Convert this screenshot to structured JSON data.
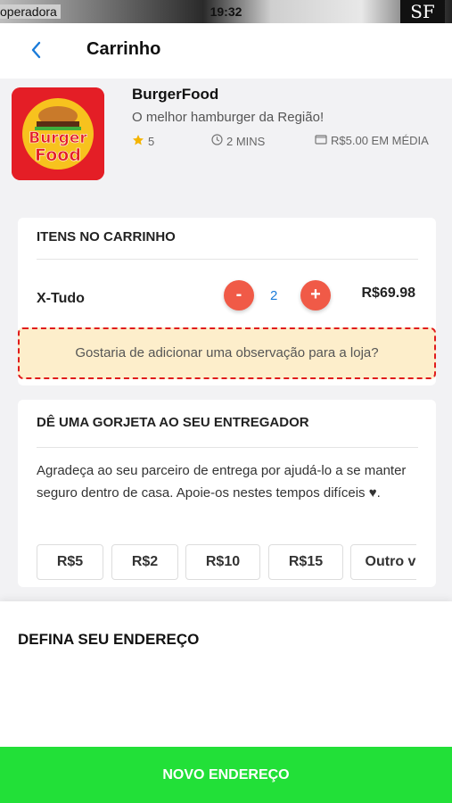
{
  "status_bar": {
    "carrier": "operadora",
    "time": "19:32",
    "corner_logo": "SF"
  },
  "header": {
    "back_icon": "chevron-left-icon",
    "title": "Carrinho"
  },
  "store": {
    "name": "BurgerFood",
    "tagline": "O melhor hamburger da Região!",
    "rating": "5",
    "delivery_time": "2 MINS",
    "avg_price": "R$5.00 EM MÉDIA",
    "logo_text_top": "Burger",
    "logo_text_bottom": "Food"
  },
  "cart": {
    "title": "ITENS NO CARRINHO",
    "items": [
      {
        "name": "X-Tudo",
        "quantity": "2",
        "price": "R$69.98",
        "minus_label": "-",
        "plus_label": "+"
      }
    ],
    "observation_prompt": "Gostaria de adicionar uma observação para a loja?"
  },
  "tip": {
    "title": "DÊ UMA GORJETA AO SEU ENTREGADOR",
    "description": "Agradeça ao seu parceiro de entrega por ajudá-lo a se manter seguro dentro de casa. Apoie-os nestes tempos difíceis ♥.",
    "options": [
      "R$5",
      "R$2",
      "R$10",
      "R$15",
      "Outro v"
    ]
  },
  "address": {
    "title": "DEFINA SEU ENDEREÇO",
    "button_label": "NOVO ENDEREÇO"
  },
  "colors": {
    "accent_blue": "#1a7bd9",
    "qty_button": "#f05a47",
    "new_address_green": "#22e038",
    "observation_bg": "#fdeecb",
    "observation_border": "#e01b1b"
  }
}
